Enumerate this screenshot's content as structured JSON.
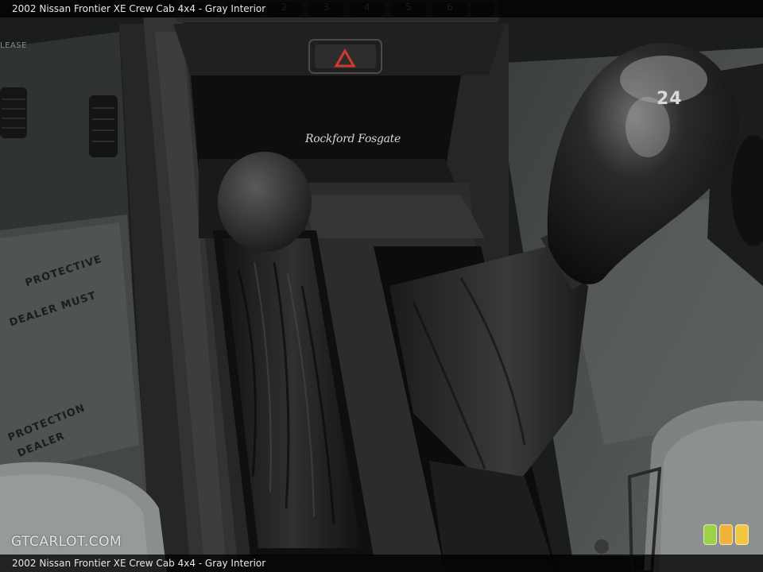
{
  "caption": {
    "top": "2002 Nissan Frontier XE Crew Cab 4x4 - Gray Interior",
    "bottom": "2002 Nissan Frontier XE Crew Cab 4x4 - Gray Interior"
  },
  "watermark": "GTCARLOT.COM",
  "dash_keys": [
    "2",
    "3",
    "4",
    "5",
    "6"
  ],
  "release_label": "LEASE",
  "brand_logo": "Rockford Fosgate",
  "shift_knob_label": "24",
  "transfer_knob_label": "4H",
  "floor_mat_text": [
    "DEALER MUST",
    "PROTECTIVE",
    "DEALER",
    "PROTECTION"
  ],
  "badge_colors": [
    "#9dd14a",
    "#f0b23a",
    "#f3c640"
  ],
  "hazard_color": "#d33a2c"
}
